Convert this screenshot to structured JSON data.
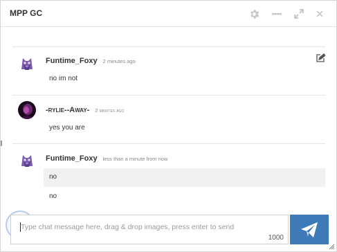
{
  "window": {
    "title": "MPP GC",
    "buttons": [
      "gear-icon",
      "minimize-icon",
      "expand-icon",
      "close-icon"
    ]
  },
  "messages": [
    {
      "author": "Funtime_Foxy",
      "timestamp": "2 minutes ago",
      "lines": [
        {
          "text": "no im not",
          "highlighted": false
        }
      ],
      "avatar": "purple-animatronic-fox",
      "editable": true
    },
    {
      "author": "-rylie--Away-",
      "timestamp": "2 minutes ago",
      "lines": [
        {
          "text": "yes you are",
          "highlighted": false
        }
      ],
      "avatar": "dark-magenta-portrait",
      "editable": false
    },
    {
      "author": "Funtime_Foxy",
      "timestamp": "less than a minute from now",
      "lines": [
        {
          "text": "no",
          "highlighted": true
        },
        {
          "text": "no",
          "highlighted": false
        }
      ],
      "avatar": "purple-animatronic-fox",
      "editable": false
    }
  ],
  "composer": {
    "placeholder": "Type chat message here, drag & drop images, press enter to send",
    "char_limit": "1000",
    "send_icon": "paper-plane-icon"
  },
  "colors": {
    "accent": "#3d7ab7",
    "highlight_row": "#f1f1f1",
    "titlebar_icons": "#c8c8c8"
  }
}
